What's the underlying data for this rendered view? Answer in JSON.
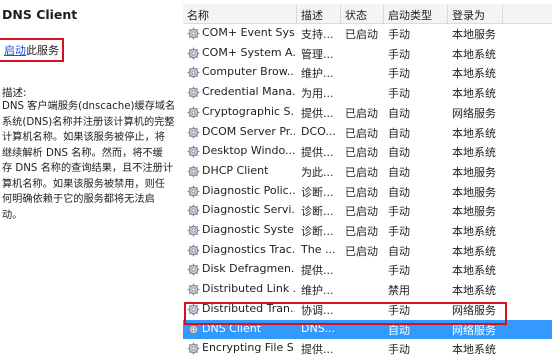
{
  "left_panel": {
    "title": "DNS Client",
    "start_link": "启动",
    "start_suffix": "此服务",
    "desc_label": "描述:",
    "desc_lines": [
      "DNS 客户端服务(dnscache)缓存域名",
      "系统(DNS)名称并注册该计算机的完整",
      "计算机名称。如果该服务被停止，将",
      "继续解析 DNS 名称。然而，将不缓",
      "存 DNS 名称的查询结果，且不注册计",
      "算机名称。如果该服务被禁用，则任",
      "何明确依赖于它的服务都将无法启",
      "动。"
    ]
  },
  "headers": [
    "名称",
    "描述",
    "状态",
    "启动类型",
    "登录为"
  ],
  "rows": [
    {
      "name": "COM+ Event Sys...",
      "desc": "支持...",
      "status": "已启动",
      "startup": "手动",
      "logon": "本地服务"
    },
    {
      "name": "COM+ System A...",
      "desc": "管理...",
      "status": "",
      "startup": "手动",
      "logon": "本地系统"
    },
    {
      "name": "Computer Brow...",
      "desc": "维护...",
      "status": "",
      "startup": "手动",
      "logon": "本地系统"
    },
    {
      "name": "Credential Mana...",
      "desc": "为用...",
      "status": "",
      "startup": "手动",
      "logon": "本地系统"
    },
    {
      "name": "Cryptographic S...",
      "desc": "提供...",
      "status": "已启动",
      "startup": "自动",
      "logon": "网络服务"
    },
    {
      "name": "DCOM Server Pr...",
      "desc": "DCO...",
      "status": "已启动",
      "startup": "自动",
      "logon": "本地系统"
    },
    {
      "name": "Desktop Windo...",
      "desc": "提供...",
      "status": "已启动",
      "startup": "自动",
      "logon": "本地系统"
    },
    {
      "name": "DHCP Client",
      "desc": "为此...",
      "status": "已启动",
      "startup": "自动",
      "logon": "本地服务"
    },
    {
      "name": "Diagnostic Polic...",
      "desc": "诊断...",
      "status": "已启动",
      "startup": "自动",
      "logon": "本地服务"
    },
    {
      "name": "Diagnostic Servi...",
      "desc": "诊断...",
      "status": "已启动",
      "startup": "手动",
      "logon": "本地服务"
    },
    {
      "name": "Diagnostic Syste...",
      "desc": "诊断...",
      "status": "已启动",
      "startup": "手动",
      "logon": "本地系统"
    },
    {
      "name": "Diagnostics Trac...",
      "desc": "The ...",
      "status": "已启动",
      "startup": "自动",
      "logon": "本地系统"
    },
    {
      "name": "Disk Defragmen...",
      "desc": "提供...",
      "status": "",
      "startup": "手动",
      "logon": "本地系统"
    },
    {
      "name": "Distributed Link ...",
      "desc": "维护...",
      "status": "",
      "startup": "禁用",
      "logon": "本地系统"
    },
    {
      "name": "Distributed Tran...",
      "desc": "协调...",
      "status": "",
      "startup": "手动",
      "logon": "网络服务"
    },
    {
      "name": "DNS Client",
      "desc": "DNS...",
      "status": "",
      "startup": "自动",
      "logon": "网络服务",
      "selected": true
    },
    {
      "name": "Encrypting File S...",
      "desc": "提供...",
      "status": "",
      "startup": "手动",
      "logon": "本地系统"
    }
  ],
  "colors": {
    "selection": "#3399ff",
    "highlight_box": "#d6111e",
    "link": "#1a4fd0"
  }
}
